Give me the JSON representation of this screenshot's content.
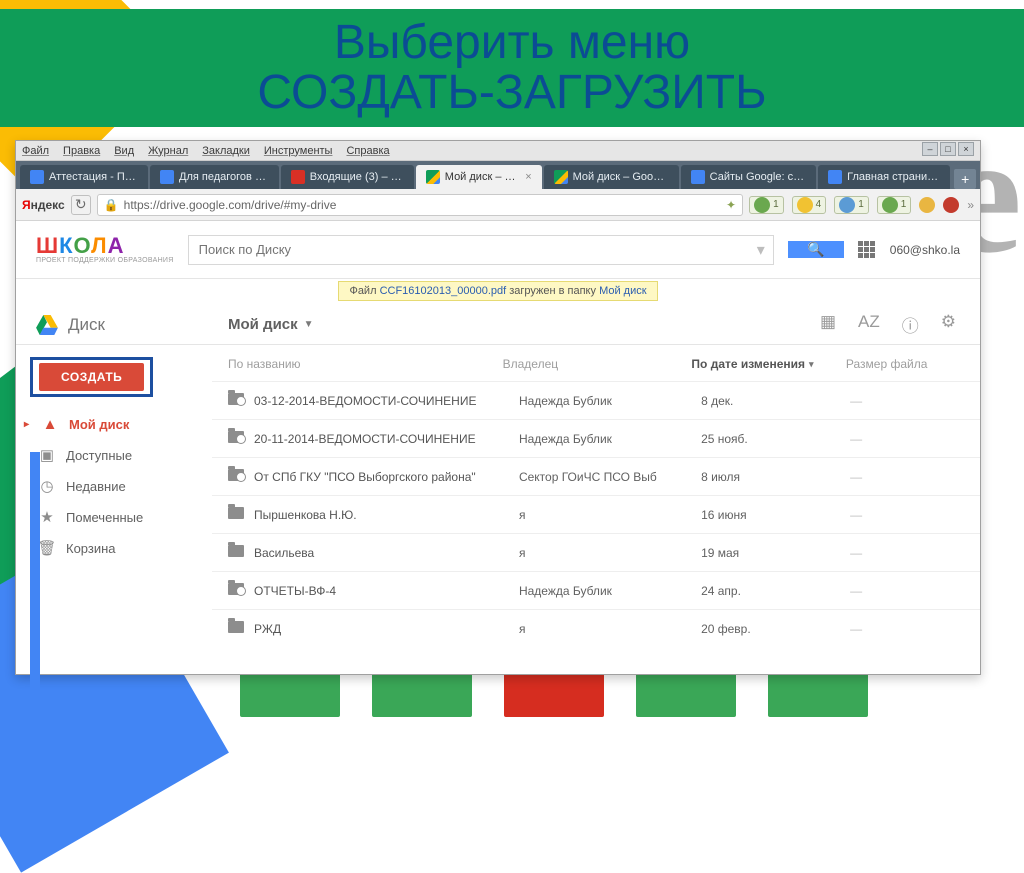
{
  "slide_title": "Выберить меню\nСОЗДАТЬ-ЗАГРУЗИТЬ",
  "menubar": [
    "Файл",
    "Правка",
    "Вид",
    "Журнал",
    "Закладки",
    "Инструменты",
    "Справка"
  ],
  "tabs": [
    {
      "label": "Аттестация - По...",
      "kind": "site"
    },
    {
      "label": "Для педагогов - ...",
      "kind": "site"
    },
    {
      "label": "Входящие (3) – 0...",
      "kind": "gmail"
    },
    {
      "label": "Мой диск – G...",
      "kind": "gd",
      "active": true
    },
    {
      "label": "Мой диск – Googl...",
      "kind": "gd"
    },
    {
      "label": "Сайты Google: са...",
      "kind": "site"
    },
    {
      "label": "Главная страниц...",
      "kind": "site"
    }
  ],
  "url": {
    "yandex": "Яндекс",
    "text": "https://drive.google.com/drive/#my-drive"
  },
  "toolbar_badges": [
    "1",
    "4",
    "1",
    "1"
  ],
  "logo_sub": "ПРОЕКТ ПОДДЕРЖКИ ОБРАЗОВАНИЯ",
  "search_placeholder": "Поиск по Диску",
  "user_email": "060@shko.la",
  "notif": {
    "pre": "Файл ",
    "file": "CCF16102013_00000.pdf",
    "mid": " загружен в папку ",
    "folder": "Мой диск"
  },
  "sidebar_head": "Диск",
  "breadcrumb": "Мой диск",
  "view_tools": [
    "▦",
    "AZ",
    "ⓘ",
    "⚙"
  ],
  "create_label": "СОЗДАТЬ",
  "nav": [
    {
      "icon": "▲",
      "label": "Мой диск",
      "active": true
    },
    {
      "icon": "▣",
      "label": "Доступные"
    },
    {
      "icon": "◷",
      "label": "Недавние"
    },
    {
      "icon": "★",
      "label": "Помеченные"
    },
    {
      "icon": "🗑",
      "label": "Корзина"
    }
  ],
  "columns": {
    "name": "По названию",
    "owner": "Владелец",
    "date": "По дате изменения",
    "size": "Размер файла"
  },
  "rows": [
    {
      "shared": true,
      "name": "03-12-2014-ВЕДОМОСТИ-СОЧИНЕНИЕ",
      "owner": "Надежда Бублик",
      "date": "8 дек.",
      "size": "—"
    },
    {
      "shared": true,
      "name": "20-11-2014-ВЕДОМОСТИ-СОЧИНЕНИЕ",
      "owner": "Надежда Бублик",
      "date": "25 нояб.",
      "size": "—"
    },
    {
      "shared": true,
      "name": "От СПб ГКУ \"ПСО Выборгского района\"",
      "owner": "Сектор ГОиЧС ПСО Выб",
      "date": "8 июля",
      "size": "—"
    },
    {
      "shared": false,
      "name": "Пыршенкова Н.Ю.",
      "owner": "я",
      "date": "16 июня",
      "size": "—"
    },
    {
      "shared": false,
      "name": "Васильева",
      "owner": "я",
      "date": "19 мая",
      "size": "—"
    },
    {
      "shared": true,
      "name": "ОТЧЕТЫ-ВФ-4",
      "owner": "Надежда Бублик",
      "date": "24 апр.",
      "size": "—"
    },
    {
      "shared": false,
      "name": "РЖД",
      "owner": "я",
      "date": "20 февр.",
      "size": "—"
    }
  ],
  "bottom_colors": [
    "#3aa757",
    "#3aa757",
    "#d62d20",
    "#3aa757",
    "#3aa757"
  ]
}
